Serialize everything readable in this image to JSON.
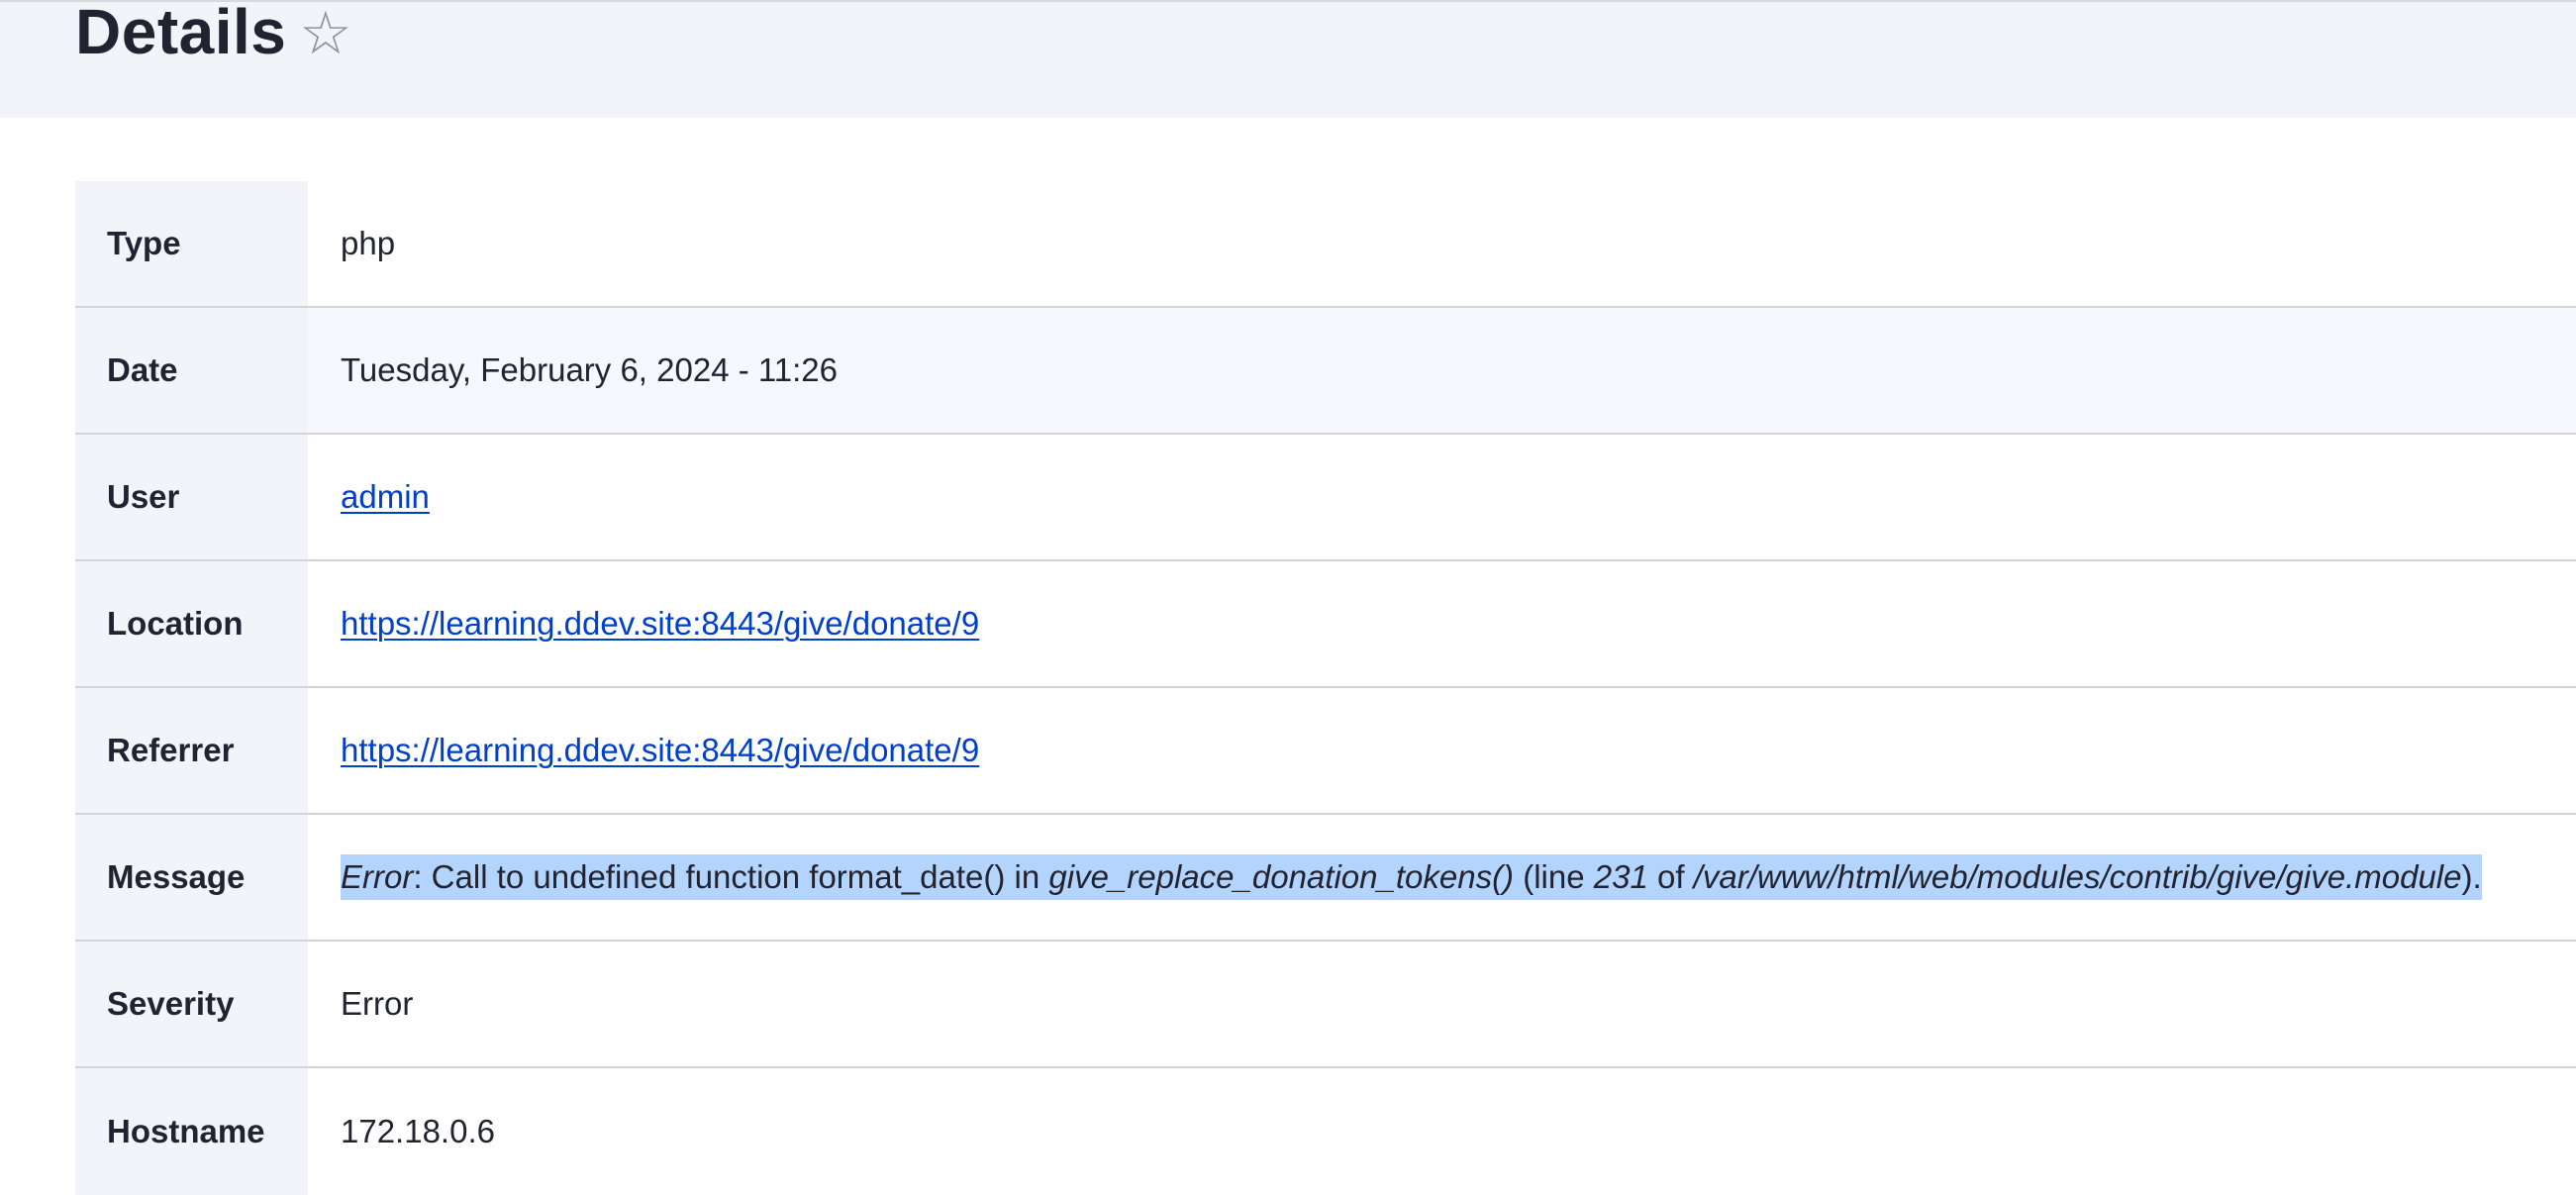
{
  "header": {
    "title": "Details",
    "star_icon": "☆"
  },
  "rows": [
    {
      "label": "Type",
      "value": "php"
    },
    {
      "label": "Date",
      "value": "Tuesday, February 6, 2024 - 11:26"
    },
    {
      "label": "User",
      "value": "admin"
    },
    {
      "label": "Location",
      "value": "https://learning.ddev.site:8443/give/donate/9"
    },
    {
      "label": "Referrer",
      "value": "https://learning.ddev.site:8443/give/donate/9"
    },
    {
      "label": "Message"
    },
    {
      "label": "Severity",
      "value": "Error"
    },
    {
      "label": "Hostname",
      "value": "172.18.0.6"
    }
  ],
  "message": {
    "part1": "Error",
    "part2": ": Call to undefined function format_date() in ",
    "part3": "give_replace_donation_tokens()",
    "part4": " (line ",
    "part5": "231",
    "part6": " of ",
    "part7": "/var/www/html/web/modules/contrib/give/give.module",
    "part8": ")."
  },
  "colors": {
    "link": "#003ecc",
    "selection": "#b3d4fc",
    "header_bg": "#f3f4f9"
  }
}
